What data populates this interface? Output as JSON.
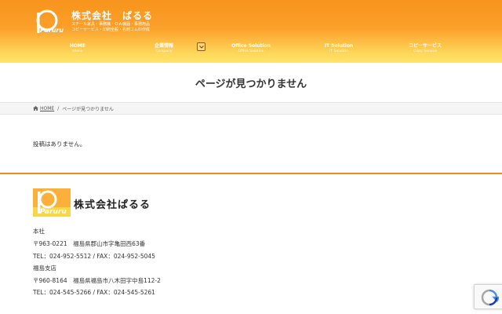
{
  "header": {
    "logo_text": "Paruru",
    "company_name": "株式会社　ぱるる",
    "tagline_1": "スチール家具・事務機・ＯＡ機器・事務用品",
    "tagline_2": "コピーサービス・印刷全般・名刺ゴム印作成",
    "nav": [
      {
        "label": "HOME",
        "sub": "Home"
      },
      {
        "label": "企業情報",
        "sub": "Company"
      },
      {
        "label": "Office Solution",
        "sub": "Office Solution"
      },
      {
        "label": "IT Solution",
        "sub": "IT Solution"
      },
      {
        "label": "コピーサービス",
        "sub": "Copy Service"
      }
    ]
  },
  "page_title": "ページが見つかりません",
  "breadcrumb": {
    "home": "HOME",
    "separator": "/",
    "current": "ページが見つかりません"
  },
  "content": {
    "message": "投稿はありません。"
  },
  "footer": {
    "logo_text": "Paruru",
    "company_name": "株式会社ぱるる",
    "lines": [
      "本社",
      "〒963-0221　福島県郡山市字亀田西63番",
      "TEL：024-952-5512 / FAX：024-952-5045",
      "福島支店",
      "〒960-8164　福島県福島市八木田字中島112-2",
      "TEL：024-545-5266 / FAX：024-545-5261"
    ]
  },
  "colors": {
    "brand_orange": "#f7941d",
    "brand_yellow": "#ffe36a",
    "footer_rule": "#f08a1c"
  }
}
